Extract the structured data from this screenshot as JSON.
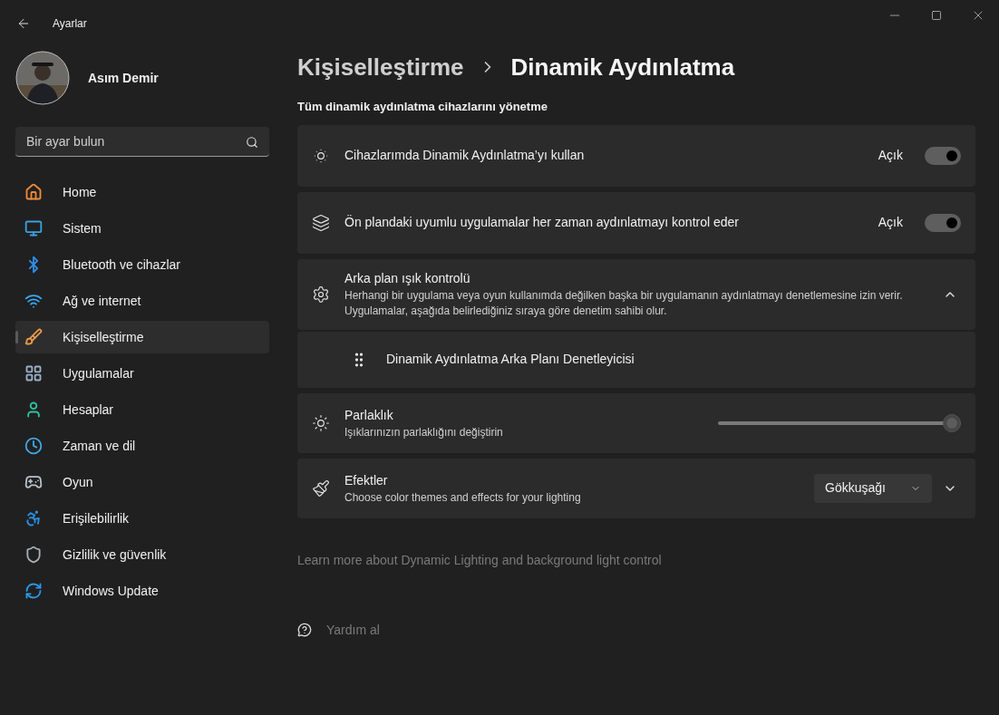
{
  "window": {
    "title": "Ayarlar"
  },
  "user": {
    "name": "Asım Demir"
  },
  "search": {
    "placeholder": "Bir ayar bulun"
  },
  "sidebar": {
    "items": [
      {
        "label": "Home",
        "selected": false
      },
      {
        "label": "Sistem",
        "selected": false
      },
      {
        "label": "Bluetooth ve cihazlar",
        "selected": false
      },
      {
        "label": "Ağ ve internet",
        "selected": false
      },
      {
        "label": "Kişiselleştirme",
        "selected": true
      },
      {
        "label": "Uygulamalar",
        "selected": false
      },
      {
        "label": "Hesaplar",
        "selected": false
      },
      {
        "label": "Zaman ve dil",
        "selected": false
      },
      {
        "label": "Oyun",
        "selected": false
      },
      {
        "label": "Erişilebilirlik",
        "selected": false
      },
      {
        "label": "Gizlilik ve güvenlik",
        "selected": false
      },
      {
        "label": "Windows Update",
        "selected": false
      }
    ]
  },
  "breadcrumb": [
    "Kişiselleştirme",
    "Dinamik Aydınlatma"
  ],
  "section_title": "Tüm dinamik aydınlatma cihazlarını yönetme",
  "settings": [
    {
      "kind": "toggle",
      "title": "Cihazlarımda Dinamik Aydınlatma’yı kullan",
      "state_label": "Açık",
      "on": true,
      "disabled": true
    },
    {
      "kind": "toggle",
      "title": "Ön plandaki uyumlu uygulamalar her zaman aydınlatmayı kontrol eder",
      "state_label": "Açık",
      "on": true,
      "disabled": true
    },
    {
      "kind": "expander",
      "title": "Arka plan ışık kontrolü",
      "description": "Herhangi bir uygulama veya oyun kullanımda değilken başka bir uygulamanın aydınlatmayı denetlemesine izin verir. Uygulamalar, aşağıda belirlediğiniz sıraya göre denetim sahibi olur.",
      "expanded": true,
      "children": [
        {
          "kind": "subitem",
          "title": "Dinamik Aydınlatma Arka Planı Denetleyicisi"
        }
      ]
    },
    {
      "kind": "slider",
      "title": "Parlaklık",
      "description": "Işıklarınızın parlaklığını değiştirin",
      "level": 1,
      "disabled": true
    },
    {
      "kind": "dropdown",
      "title": "Efektler",
      "description": "Choose color themes and effects for your lighting",
      "value": "Gökkuşağı",
      "expanded": false
    }
  ],
  "learn_more": "Learn more about Dynamic Lighting and background light control",
  "help": "Yardım al"
}
